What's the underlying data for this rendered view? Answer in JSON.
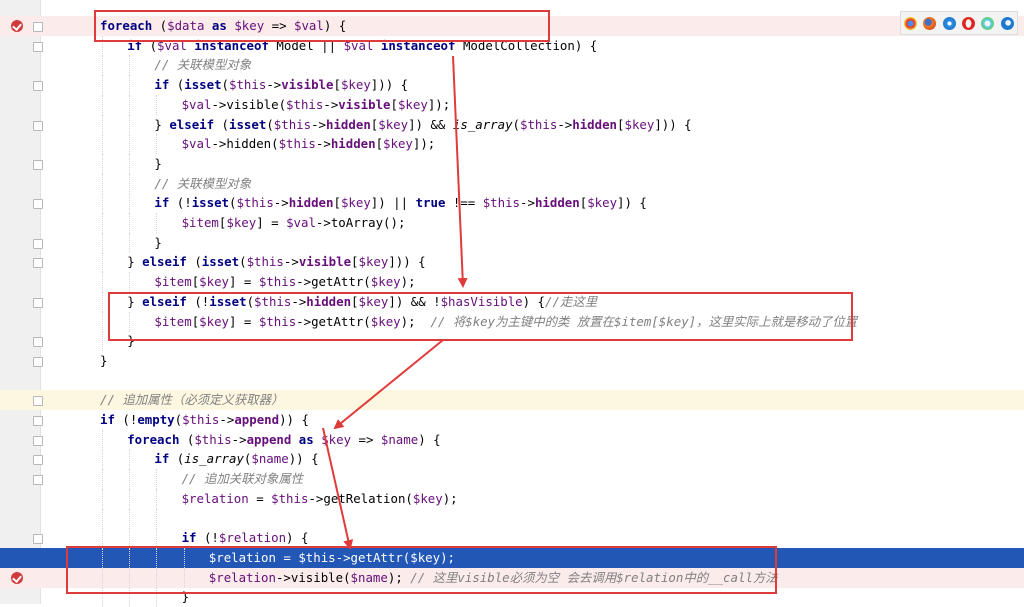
{
  "colors": {
    "box": "#e03b3b",
    "selection": "#2257b6",
    "keyword": "#000080",
    "variable": "#660e7a",
    "comment": "#808080"
  },
  "browser_icons": [
    "chrome-icon",
    "firefox-icon",
    "safari-icon",
    "opera-icon",
    "ie-icon",
    "edge-icon"
  ],
  "code_lines": [
    "foreach ($data as $key => $val) {",
    "if ($val instanceof Model || $val instanceof ModelCollection) {",
    "// 关联模型对象",
    "if (isset($this->visible[$key])) {",
    "$val->visible($this->visible[$key]);",
    "} elseif (isset($this->hidden[$key]) && is_array($this->hidden[$key])) {",
    "$val->hidden($this->hidden[$key]);",
    "}",
    "// 关联模型对象",
    "if (!isset($this->hidden[$key]) || true !== $this->hidden[$key]) {",
    "$item[$key] = $val->toArray();",
    "}",
    "} elseif (isset($this->visible[$key])) {",
    "$item[$key] = $this->getAttr($key);",
    "} elseif (!isset($this->hidden[$key]) && !$hasVisible) {//走这里",
    "$item[$key] = $this->getAttr($key);  // 将$key为主键中的类 放置在$item[$key]，这里实际上就是移动了位置",
    "}",
    "}",
    "",
    "// 追加属性（必须定义获取器）",
    "if (!empty($this->append)) {",
    "foreach ($this->append as $key => $name) {",
    "if (is_array($name)) {",
    "// 追加关联对象属性",
    "$relation = $this->getRelation($key);",
    "",
    "if (!$relation) {",
    "$relation = $this->getAttr($key);",
    "$relation->visible($name); // 这里visible必须为空 会去调用$relation中的__call方法",
    "}"
  ]
}
